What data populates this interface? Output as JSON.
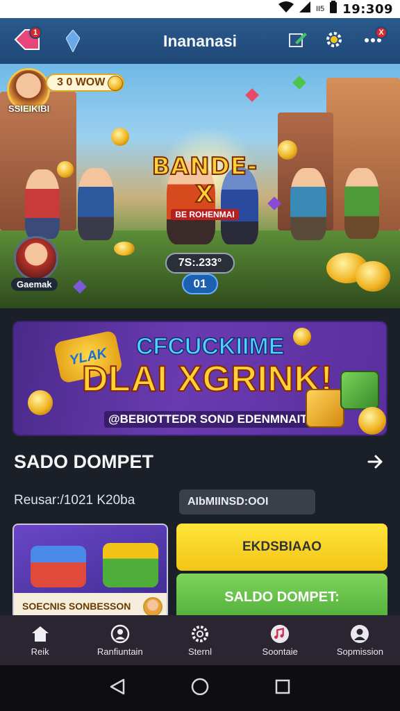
{
  "status_bar": {
    "battery_text": "II5",
    "time": "19:309"
  },
  "header": {
    "title": "Inananasi",
    "back_badge": "1",
    "more_badge": "X"
  },
  "hero": {
    "top_coins": "3 0 WOW",
    "top_player": "SSIEIKIBI",
    "logo": "BANDE-X",
    "logo_sub": "BE ROHENMAI",
    "bottom_player": "Gaemak",
    "score": "7S:.233°",
    "level": "01"
  },
  "promo": {
    "badge": "YLAK",
    "title": "CFCUCKIIME",
    "headline": "DLAI XGRINK!",
    "subtitle": "@BEBIOTTEDR SOND EDENMNAITE"
  },
  "wallet": {
    "title": "SADO DOMPET",
    "balance_label": "Reusar:/1021 K20ba",
    "amount_field": "AIbMIINSD:OOI"
  },
  "cards": {
    "game_caption": "SOECNIS SONBESSON",
    "yellow_button": "EKDSBIAAO",
    "green_button": "SALDO DOMPET:"
  },
  "bottom_nav": [
    {
      "label": "Reik",
      "icon": "home-icon"
    },
    {
      "label": "Ranfiuntain",
      "icon": "profile-icon"
    },
    {
      "label": "Sternl",
      "icon": "settings-icon"
    },
    {
      "label": "Soontaie",
      "icon": "music-icon"
    },
    {
      "label": "Sopmission",
      "icon": "user-icon"
    }
  ],
  "colors": {
    "header": "#1e4777",
    "accent_yellow": "#f2c418",
    "accent_green": "#4fae3a",
    "nav_bg": "#2a2530"
  }
}
